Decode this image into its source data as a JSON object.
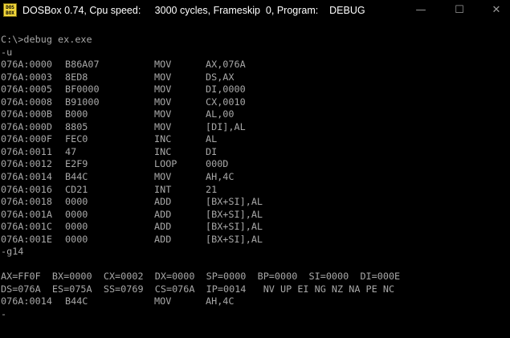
{
  "window": {
    "title": "DOSBox 0.74, Cpu speed:     3000 cycles, Frameskip  0, Program:    DEBUG",
    "icon_label_top": "DOS",
    "icon_label_bottom": "BOX",
    "buttons": {
      "minimize": "—",
      "maximize": "☐",
      "close": "✕"
    }
  },
  "console": {
    "command_line": "C:\\>debug ex.exe",
    "unassemble_cmd": "-u",
    "listing": [
      {
        "addr": "076A:0000",
        "hex": "B86A07",
        "mnem": "MOV",
        "ops": "AX,076A"
      },
      {
        "addr": "076A:0003",
        "hex": "8ED8",
        "mnem": "MOV",
        "ops": "DS,AX"
      },
      {
        "addr": "076A:0005",
        "hex": "BF0000",
        "mnem": "MOV",
        "ops": "DI,0000"
      },
      {
        "addr": "076A:0008",
        "hex": "B91000",
        "mnem": "MOV",
        "ops": "CX,0010"
      },
      {
        "addr": "076A:000B",
        "hex": "B000",
        "mnem": "MOV",
        "ops": "AL,00"
      },
      {
        "addr": "076A:000D",
        "hex": "8805",
        "mnem": "MOV",
        "ops": "[DI],AL"
      },
      {
        "addr": "076A:000F",
        "hex": "FEC0",
        "mnem": "INC",
        "ops": "AL"
      },
      {
        "addr": "076A:0011",
        "hex": "47",
        "mnem": "INC",
        "ops": "DI"
      },
      {
        "addr": "076A:0012",
        "hex": "E2F9",
        "mnem": "LOOP",
        "ops": "000D"
      },
      {
        "addr": "076A:0014",
        "hex": "B44C",
        "mnem": "MOV",
        "ops": "AH,4C"
      },
      {
        "addr": "076A:0016",
        "hex": "CD21",
        "mnem": "INT",
        "ops": "21"
      },
      {
        "addr": "076A:0018",
        "hex": "0000",
        "mnem": "ADD",
        "ops": "[BX+SI],AL"
      },
      {
        "addr": "076A:001A",
        "hex": "0000",
        "mnem": "ADD",
        "ops": "[BX+SI],AL"
      },
      {
        "addr": "076A:001C",
        "hex": "0000",
        "mnem": "ADD",
        "ops": "[BX+SI],AL"
      },
      {
        "addr": "076A:001E",
        "hex": "0000",
        "mnem": "ADD",
        "ops": "[BX+SI],AL"
      }
    ],
    "go_cmd": "-g14",
    "registers_line1": "AX=FF0F  BX=0000  CX=0002  DX=0000  SP=0000  BP=0000  SI=0000  DI=000E",
    "registers_line2": "DS=076A  ES=075A  SS=0769  CS=076A  IP=0014   NV UP EI NG NZ NA PE NC",
    "current": {
      "addr": "076A:0014",
      "hex": "B44C",
      "mnem": "MOV",
      "ops": "AH,4C"
    },
    "prompt": "-"
  },
  "colors": {
    "background": "#000000",
    "text": "#a8a8a8",
    "titlebar_text": "#ffffff"
  }
}
